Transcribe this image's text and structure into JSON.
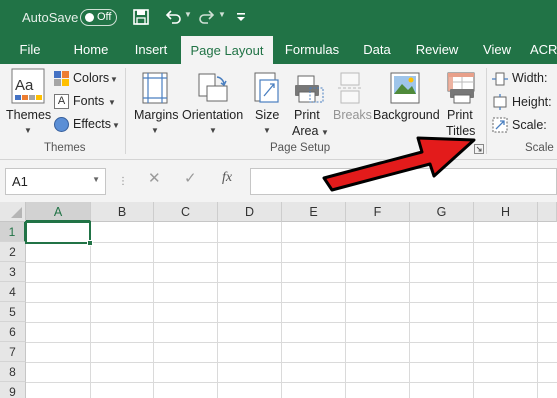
{
  "titlebar": {
    "autosave_label": "AutoSave",
    "autosave_state": "Off",
    "icons": [
      "save-icon",
      "undo-icon",
      "redo-icon",
      "customize-qat-icon"
    ]
  },
  "tabs": [
    "File",
    "Home",
    "Insert",
    "Page Layout",
    "Formulas",
    "Data",
    "Review",
    "View",
    "ACR"
  ],
  "active_tab": "Page Layout",
  "ribbon": {
    "themes": {
      "themes_label": "Themes",
      "colors_label": "Colors",
      "fonts_label": "Fonts",
      "effects_label": "Effects",
      "group_label": "Themes"
    },
    "page_setup": {
      "margins_label": "Margins",
      "orientation_label": "Orientation",
      "size_label": "Size",
      "print_area_line1": "Print",
      "print_area_line2": "Area",
      "breaks_label": "Breaks",
      "background_label": "Background",
      "print_titles_line1": "Print",
      "print_titles_line2": "Titles",
      "group_label": "Page Setup"
    },
    "scale": {
      "width_label": "Width:",
      "height_label": "Height:",
      "scale_label": "Scale:",
      "group_label": "Scale"
    }
  },
  "formula_bar": {
    "name_box": "A1",
    "fx_label": "fx",
    "formula_value": ""
  },
  "grid": {
    "columns": [
      "A",
      "B",
      "C",
      "D",
      "E",
      "F",
      "G",
      "H"
    ],
    "rows": [
      "1",
      "2",
      "3",
      "4",
      "5",
      "6",
      "7",
      "8",
      "9"
    ],
    "selected_cell": "A1"
  },
  "colors": {
    "excel_green": "#217346",
    "arrow_red": "#e31b1b"
  }
}
